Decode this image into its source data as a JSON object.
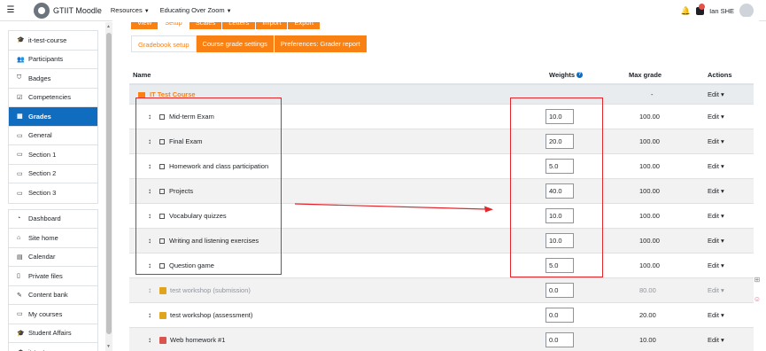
{
  "topbar": {
    "menu_icon": "hamburger-icon",
    "brand": "GTIIT Moodle",
    "nav": [
      {
        "label": "Resources"
      },
      {
        "label": "Educating Over Zoom"
      }
    ],
    "user": "Ian SHE"
  },
  "drawer": {
    "group1": [
      {
        "label": "it-test-course",
        "icon": "graduation-cap-icon"
      },
      {
        "label": "Participants",
        "icon": "users-icon"
      },
      {
        "label": "Badges",
        "icon": "shield-icon"
      },
      {
        "label": "Competencies",
        "icon": "check-square-icon"
      },
      {
        "label": "Grades",
        "icon": "table-icon",
        "active": true
      },
      {
        "label": "General",
        "icon": "folder-icon"
      },
      {
        "label": "Section 1",
        "icon": "folder-icon"
      },
      {
        "label": "Section 2",
        "icon": "folder-icon"
      },
      {
        "label": "Section 3",
        "icon": "folder-icon"
      }
    ],
    "group2": [
      {
        "label": "Dashboard",
        "icon": "dashboard-icon"
      },
      {
        "label": "Site home",
        "icon": "home-icon"
      },
      {
        "label": "Calendar",
        "icon": "calendar-icon"
      },
      {
        "label": "Private files",
        "icon": "file-icon"
      },
      {
        "label": "Content bank",
        "icon": "brush-icon"
      },
      {
        "label": "My courses",
        "icon": "folder-icon"
      },
      {
        "label": "Student Affairs",
        "icon": "graduation-cap-icon"
      },
      {
        "label": "it-test-course",
        "icon": "graduation-cap-icon"
      }
    ]
  },
  "tabs_top": [
    "View",
    "Setup",
    "Scales",
    "Letters",
    "Import",
    "Export"
  ],
  "tabs_setup": [
    "Gradebook setup",
    "Course grade settings",
    "Preferences: Grader report"
  ],
  "table": {
    "headers": {
      "name": "Name",
      "weights": "Weights",
      "max": "Max grade",
      "actions": "Actions"
    },
    "category": {
      "name": "IT Test Course",
      "max": "-",
      "action": "Edit"
    },
    "rows": [
      {
        "name": "Mid-term Exam",
        "weight": "10.0",
        "max": "100.00",
        "action": "Edit",
        "type": "item"
      },
      {
        "name": "Final Exam",
        "weight": "20.0",
        "max": "100.00",
        "action": "Edit",
        "type": "item"
      },
      {
        "name": "Homework and class participation",
        "weight": "5.0",
        "max": "100.00",
        "action": "Edit",
        "type": "item"
      },
      {
        "name": "Projects",
        "weight": "40.0",
        "max": "100.00",
        "action": "Edit",
        "type": "item"
      },
      {
        "name": "Vocabulary quizzes",
        "weight": "10.0",
        "max": "100.00",
        "action": "Edit",
        "type": "item"
      },
      {
        "name": "Writing and listening exercises",
        "weight": "10.0",
        "max": "100.00",
        "action": "Edit",
        "type": "item"
      },
      {
        "name": "Question game",
        "weight": "5.0",
        "max": "100.00",
        "action": "Edit",
        "type": "item"
      },
      {
        "name": "test workshop (submission)",
        "weight": "0.0",
        "max": "80.00",
        "action": "Edit",
        "type": "workshop",
        "hidden": true
      },
      {
        "name": "test workshop (assessment)",
        "weight": "0.0",
        "max": "20.00",
        "action": "Edit",
        "type": "workshop"
      },
      {
        "name": "Web homework #1",
        "weight": "0.0",
        "max": "10.00",
        "action": "Edit",
        "type": "assign"
      }
    ]
  },
  "colors": {
    "accent": "#f98012",
    "primary": "#0f6cbf",
    "annotation": "#e3262b"
  }
}
